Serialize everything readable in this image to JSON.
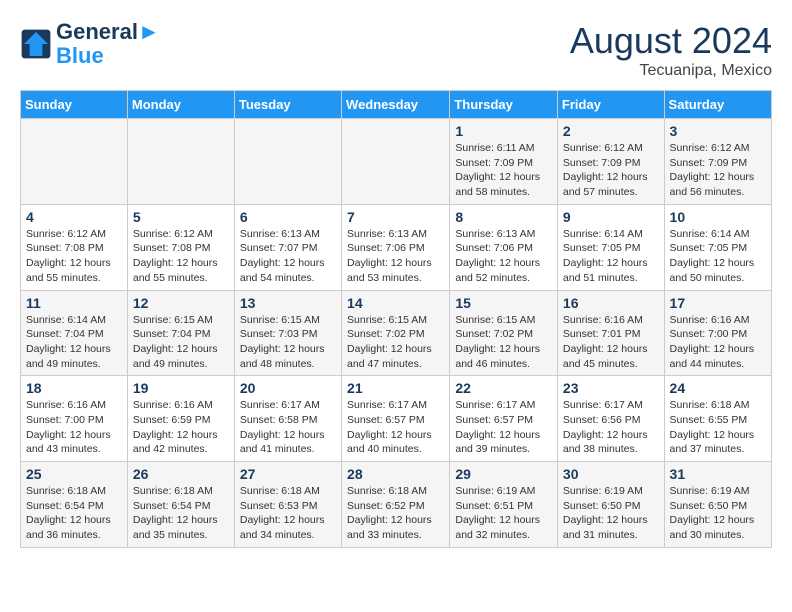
{
  "logo": {
    "line1": "General",
    "line2": "Blue"
  },
  "title": {
    "month_year": "August 2024",
    "location": "Tecuanipa, Mexico"
  },
  "weekdays": [
    "Sunday",
    "Monday",
    "Tuesday",
    "Wednesday",
    "Thursday",
    "Friday",
    "Saturday"
  ],
  "weeks": [
    [
      {
        "day": "",
        "info": ""
      },
      {
        "day": "",
        "info": ""
      },
      {
        "day": "",
        "info": ""
      },
      {
        "day": "",
        "info": ""
      },
      {
        "day": "1",
        "info": "Sunrise: 6:11 AM\nSunset: 7:09 PM\nDaylight: 12 hours\nand 58 minutes."
      },
      {
        "day": "2",
        "info": "Sunrise: 6:12 AM\nSunset: 7:09 PM\nDaylight: 12 hours\nand 57 minutes."
      },
      {
        "day": "3",
        "info": "Sunrise: 6:12 AM\nSunset: 7:09 PM\nDaylight: 12 hours\nand 56 minutes."
      }
    ],
    [
      {
        "day": "4",
        "info": "Sunrise: 6:12 AM\nSunset: 7:08 PM\nDaylight: 12 hours\nand 55 minutes."
      },
      {
        "day": "5",
        "info": "Sunrise: 6:12 AM\nSunset: 7:08 PM\nDaylight: 12 hours\nand 55 minutes."
      },
      {
        "day": "6",
        "info": "Sunrise: 6:13 AM\nSunset: 7:07 PM\nDaylight: 12 hours\nand 54 minutes."
      },
      {
        "day": "7",
        "info": "Sunrise: 6:13 AM\nSunset: 7:06 PM\nDaylight: 12 hours\nand 53 minutes."
      },
      {
        "day": "8",
        "info": "Sunrise: 6:13 AM\nSunset: 7:06 PM\nDaylight: 12 hours\nand 52 minutes."
      },
      {
        "day": "9",
        "info": "Sunrise: 6:14 AM\nSunset: 7:05 PM\nDaylight: 12 hours\nand 51 minutes."
      },
      {
        "day": "10",
        "info": "Sunrise: 6:14 AM\nSunset: 7:05 PM\nDaylight: 12 hours\nand 50 minutes."
      }
    ],
    [
      {
        "day": "11",
        "info": "Sunrise: 6:14 AM\nSunset: 7:04 PM\nDaylight: 12 hours\nand 49 minutes."
      },
      {
        "day": "12",
        "info": "Sunrise: 6:15 AM\nSunset: 7:04 PM\nDaylight: 12 hours\nand 49 minutes."
      },
      {
        "day": "13",
        "info": "Sunrise: 6:15 AM\nSunset: 7:03 PM\nDaylight: 12 hours\nand 48 minutes."
      },
      {
        "day": "14",
        "info": "Sunrise: 6:15 AM\nSunset: 7:02 PM\nDaylight: 12 hours\nand 47 minutes."
      },
      {
        "day": "15",
        "info": "Sunrise: 6:15 AM\nSunset: 7:02 PM\nDaylight: 12 hours\nand 46 minutes."
      },
      {
        "day": "16",
        "info": "Sunrise: 6:16 AM\nSunset: 7:01 PM\nDaylight: 12 hours\nand 45 minutes."
      },
      {
        "day": "17",
        "info": "Sunrise: 6:16 AM\nSunset: 7:00 PM\nDaylight: 12 hours\nand 44 minutes."
      }
    ],
    [
      {
        "day": "18",
        "info": "Sunrise: 6:16 AM\nSunset: 7:00 PM\nDaylight: 12 hours\nand 43 minutes."
      },
      {
        "day": "19",
        "info": "Sunrise: 6:16 AM\nSunset: 6:59 PM\nDaylight: 12 hours\nand 42 minutes."
      },
      {
        "day": "20",
        "info": "Sunrise: 6:17 AM\nSunset: 6:58 PM\nDaylight: 12 hours\nand 41 minutes."
      },
      {
        "day": "21",
        "info": "Sunrise: 6:17 AM\nSunset: 6:57 PM\nDaylight: 12 hours\nand 40 minutes."
      },
      {
        "day": "22",
        "info": "Sunrise: 6:17 AM\nSunset: 6:57 PM\nDaylight: 12 hours\nand 39 minutes."
      },
      {
        "day": "23",
        "info": "Sunrise: 6:17 AM\nSunset: 6:56 PM\nDaylight: 12 hours\nand 38 minutes."
      },
      {
        "day": "24",
        "info": "Sunrise: 6:18 AM\nSunset: 6:55 PM\nDaylight: 12 hours\nand 37 minutes."
      }
    ],
    [
      {
        "day": "25",
        "info": "Sunrise: 6:18 AM\nSunset: 6:54 PM\nDaylight: 12 hours\nand 36 minutes."
      },
      {
        "day": "26",
        "info": "Sunrise: 6:18 AM\nSunset: 6:54 PM\nDaylight: 12 hours\nand 35 minutes."
      },
      {
        "day": "27",
        "info": "Sunrise: 6:18 AM\nSunset: 6:53 PM\nDaylight: 12 hours\nand 34 minutes."
      },
      {
        "day": "28",
        "info": "Sunrise: 6:18 AM\nSunset: 6:52 PM\nDaylight: 12 hours\nand 33 minutes."
      },
      {
        "day": "29",
        "info": "Sunrise: 6:19 AM\nSunset: 6:51 PM\nDaylight: 12 hours\nand 32 minutes."
      },
      {
        "day": "30",
        "info": "Sunrise: 6:19 AM\nSunset: 6:50 PM\nDaylight: 12 hours\nand 31 minutes."
      },
      {
        "day": "31",
        "info": "Sunrise: 6:19 AM\nSunset: 6:50 PM\nDaylight: 12 hours\nand 30 minutes."
      }
    ]
  ]
}
